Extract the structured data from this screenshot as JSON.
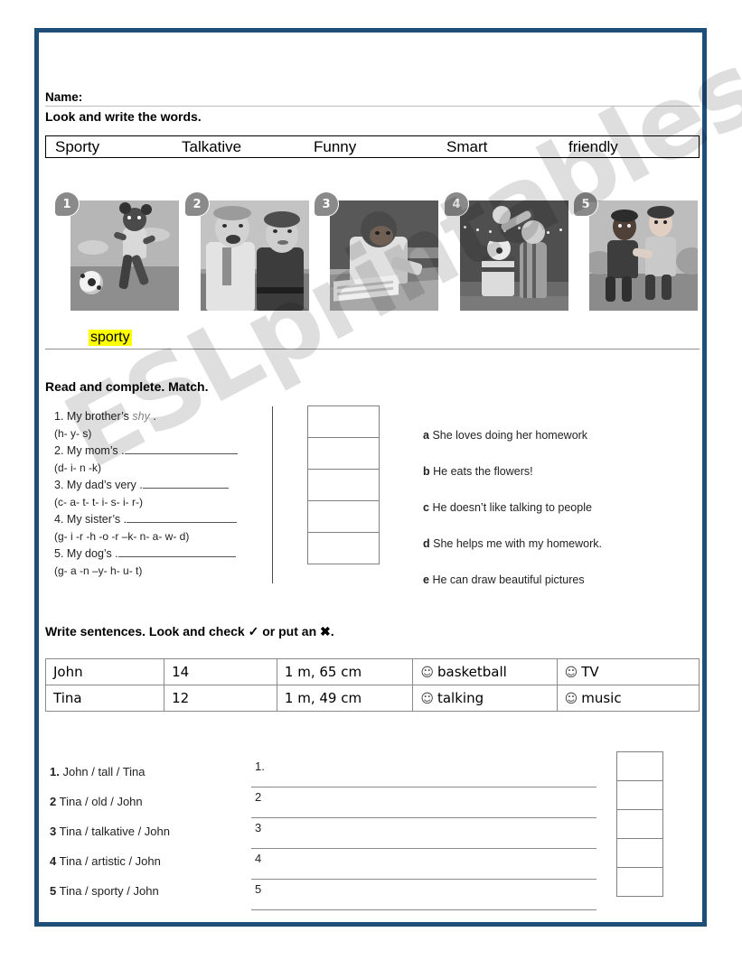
{
  "page": {
    "border_color": "#1F4E79",
    "watermark": "ESLprintables.com",
    "highlight_color": "#FFFF00"
  },
  "name_field": {
    "label": "Name:",
    "value": ""
  },
  "exercise_1": {
    "heading": "Look and write the words.",
    "word_bank": [
      "Sporty",
      "Talkative",
      "Funny",
      "Smart",
      "friendly"
    ],
    "pictures": [
      {
        "number": "1",
        "description": "girl playing soccer outdoors"
      },
      {
        "number": "2",
        "description": "two men talking and laughing"
      },
      {
        "number": "3",
        "description": "girl studying at a desk with books"
      },
      {
        "number": "4",
        "description": "clowns performing on a stage"
      },
      {
        "number": "5",
        "description": "two boys greeting each other"
      }
    ],
    "answers": [
      {
        "number": "1",
        "value": "sporty",
        "highlighted": true
      },
      {
        "number": "2",
        "value": ""
      },
      {
        "number": "3",
        "value": ""
      },
      {
        "number": "4",
        "value": ""
      },
      {
        "number": "5",
        "value": ""
      }
    ]
  },
  "exercise_2": {
    "heading": "Read and complete. Match.",
    "items": [
      {
        "number": "1.",
        "text_before": "My brother’s",
        "answer": "shy",
        "answer_filled": true,
        "text_after": ".",
        "hint": "(h- y- s)"
      },
      {
        "number": "2.",
        "text_before": "My mom’s .",
        "answer": "",
        "answer_filled": false,
        "text_after": "",
        "hint": "(d- i- n -k)"
      },
      {
        "number": "3.",
        "text_before": "My dad’s very .",
        "answer": "",
        "answer_filled": false,
        "text_after": "",
        "hint": "(c- a- t- t- i- s- i- r-)"
      },
      {
        "number": "4.",
        "text_before": "My sister’s .",
        "answer": "",
        "answer_filled": false,
        "text_after": "",
        "hint": "(g- i -r -h -o -r –k- n- a- w- d)"
      },
      {
        "number": "5.",
        "text_before": "My dog’s .",
        "answer": "",
        "answer_filled": false,
        "text_after": "",
        "hint": "(g- a -n –y- h- u- t)"
      }
    ],
    "match_boxes": [
      "",
      "",
      "",
      "",
      ""
    ],
    "options": [
      {
        "letter": "a",
        "text": "She loves doing her homework"
      },
      {
        "letter": "b",
        "text": "He eats the flowers!"
      },
      {
        "letter": "c",
        "text": "He doesn’t like talking to people"
      },
      {
        "letter": "d",
        "text": "She helps me with my homework."
      },
      {
        "letter": "e",
        "text": "He can draw beautiful pictures"
      }
    ]
  },
  "exercise_3": {
    "heading_part1": "Write sentences. Look and check",
    "check_symbol": "✓",
    "heading_part2": "or put an",
    "cross_symbol": "✖",
    "heading_part3": ".",
    "table": {
      "rows": [
        {
          "name": "John",
          "age": "14",
          "height": "1 m, 65 cm",
          "like1": "basketball",
          "like2": "TV",
          "icon": "smiley-icon"
        },
        {
          "name": "Tina",
          "age": "12",
          "height": "1 m, 49 cm",
          "like1": "talking",
          "like2": "music",
          "icon": "smiley-icon"
        }
      ]
    },
    "prompts": [
      {
        "number": "1.",
        "text": "John / tall / Tina"
      },
      {
        "number": "2",
        "text": "Tina / old / John"
      },
      {
        "number": "3",
        "text": "Tina / talkative / John"
      },
      {
        "number": "4",
        "text": "Tina / artistic / John"
      },
      {
        "number": "5",
        "text": "Tina / sporty / John"
      }
    ],
    "answer_lines": [
      {
        "number": "1.",
        "value": ""
      },
      {
        "number": "2",
        "value": ""
      },
      {
        "number": "3",
        "value": ""
      },
      {
        "number": "4",
        "value": ""
      },
      {
        "number": "5",
        "value": ""
      }
    ],
    "check_boxes": [
      "",
      "",
      "",
      "",
      ""
    ]
  }
}
